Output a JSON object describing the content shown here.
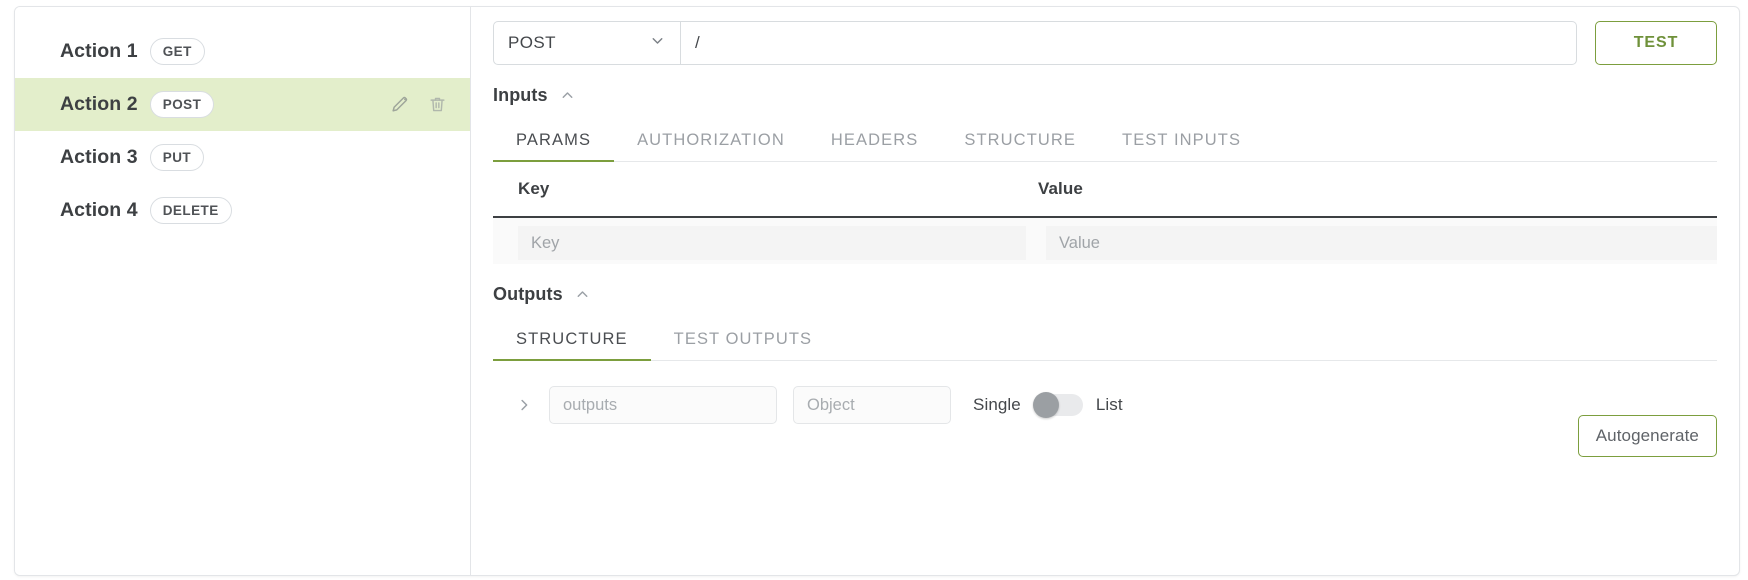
{
  "theme": {
    "accent_green": "#7c9e3e",
    "selected_row_bg": "#e3eecb",
    "text_dark": "#3d4043",
    "text_muted": "#9b9fa4"
  },
  "actions_list": {
    "items": [
      {
        "label": "Action 1",
        "method": "GET",
        "selected": false
      },
      {
        "label": "Action 2",
        "method": "POST",
        "selected": true
      },
      {
        "label": "Action 3",
        "method": "PUT",
        "selected": false
      },
      {
        "label": "Action 4",
        "method": "DELETE",
        "selected": false
      }
    ],
    "row_tools": {
      "edit_icon": "pencil-icon",
      "delete_icon": "trash-icon"
    }
  },
  "request_bar": {
    "method_value": "POST",
    "method_options": [
      "GET",
      "POST",
      "PUT",
      "DELETE",
      "PATCH"
    ],
    "path_value": "/",
    "path_placeholder": "/",
    "test_label": "TEST",
    "dropdown_icon": "chevron-down-icon"
  },
  "inputs_section": {
    "title": "Inputs",
    "collapse_icon": "chevron-up-icon",
    "tabs": [
      {
        "label": "PARAMS",
        "active": true
      },
      {
        "label": "AUTHORIZATION",
        "active": false
      },
      {
        "label": "HEADERS",
        "active": false
      },
      {
        "label": "STRUCTURE",
        "active": false
      },
      {
        "label": "TEST INPUTS",
        "active": false
      }
    ],
    "params_table": {
      "columns": [
        "Key",
        "Value"
      ],
      "rows": [
        {
          "key_value": "",
          "key_placeholder": "Key",
          "value_value": "",
          "value_placeholder": "Value"
        }
      ]
    }
  },
  "outputs_section": {
    "title": "Outputs",
    "collapse_icon": "chevron-up-icon",
    "tabs": [
      {
        "label": "STRUCTURE",
        "active": true
      },
      {
        "label": "TEST OUTPUTS",
        "active": false
      }
    ],
    "structure_row": {
      "expand_icon": "chevron-right-icon",
      "name_value": "",
      "name_placeholder": "outputs",
      "type_value": "",
      "type_placeholder": "Object",
      "toggle_left_label": "Single",
      "toggle_right_label": "List",
      "toggle_state": "single"
    },
    "autogenerate_label": "Autogenerate"
  }
}
